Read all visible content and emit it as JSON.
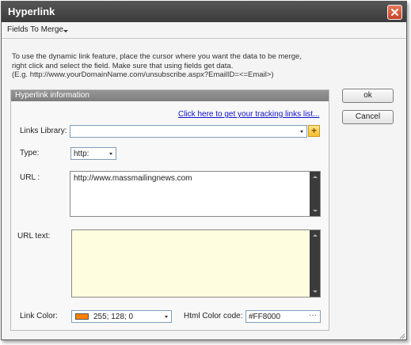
{
  "window": {
    "title": "Hyperlink"
  },
  "menubar": {
    "fields_to_merge": "Fields To Merge"
  },
  "instructions": {
    "line1": "To use the dynamic link feature, place the cursor where you want the data to be merge,",
    "line2": "right click and select the field. Make sure that using fields get data.",
    "line3": "(E.g. http://www.yourDomainName.com/unsubscribe.aspx?EmailID=<=Email>)"
  },
  "panel": {
    "header": "Hyperlink information",
    "tracking_link": "Click here to get your tracking links list..."
  },
  "form": {
    "links_library_label": "Links Library:",
    "links_library_value": "",
    "type_label": "Type:",
    "type_value": "http:",
    "url_label": "URL :",
    "url_value": "http://www.massmailingnews.com",
    "url_text_label": "URL text:",
    "url_text_value": "",
    "link_color_label": "Link Color:",
    "link_color_value": "255; 128; 0",
    "html_color_label": "Html Color code:",
    "html_color_value": "#FF8000",
    "html_color_button": "···"
  },
  "buttons": {
    "ok": "ok",
    "cancel": "Cancel"
  },
  "colors": {
    "link_color": "#FF8000",
    "url_text_background": "#FFFDE0",
    "title_bar": "#444444",
    "panel_header": "#8A8A8A"
  }
}
